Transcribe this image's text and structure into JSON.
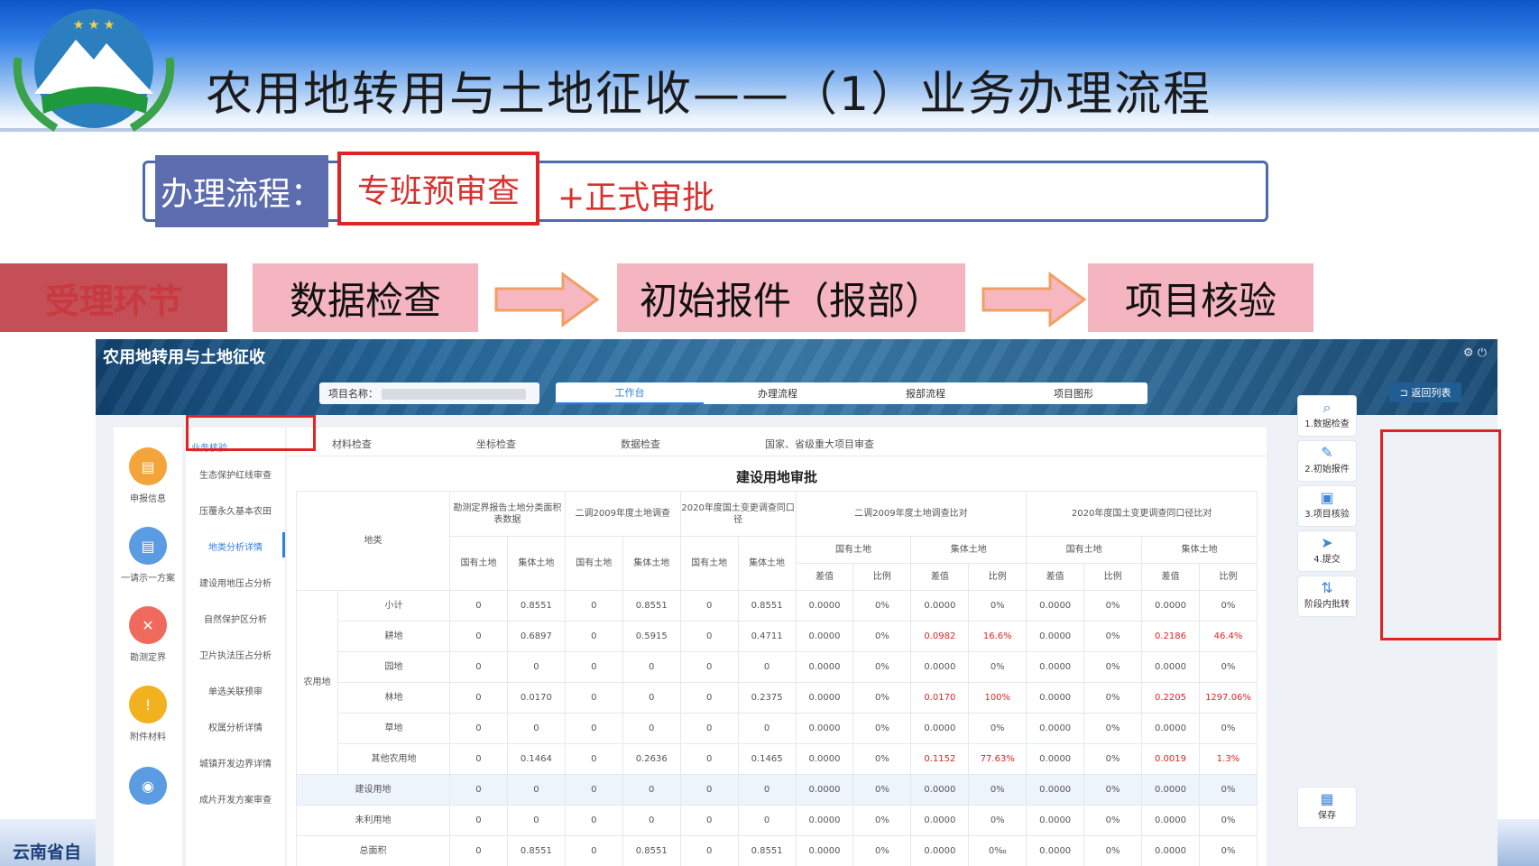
{
  "slide": {
    "title": "农用地转用与土地征收——（1）业务办理流程",
    "footer_text": "云南省自"
  },
  "process": {
    "label": "办理流程：",
    "step1": "专班预审查",
    "step2": "+正式审批"
  },
  "stages": {
    "label": "受理环节",
    "items": [
      "数据检查",
      "初始报件（报部）",
      "项目核验"
    ]
  },
  "app": {
    "title": "农用地转用与土地征收",
    "project_name_label": "项目名称：",
    "tabs": [
      "工作台",
      "办理流程",
      "报部流程",
      "项目图形"
    ],
    "active_tab": "工作台",
    "back_label": "返回列表",
    "left_nav": [
      "申报信息",
      "一请示一方案",
      "勘测定界",
      "附件材料"
    ],
    "sub_nav": {
      "header": "业务核验",
      "items": [
        "生态保护红线审查",
        "压覆永久基本农田",
        "地类分析详情",
        "建设用地压占分析",
        "自然保护区分析",
        "卫片执法压占分析",
        "单选关联预审",
        "权属分析详情",
        "城镇开发边界详情",
        "成片开发方案审查"
      ],
      "active": "地类分析详情"
    },
    "sub_tabs": [
      "材料检查",
      "坐标检查",
      "数据检查",
      "国家、省级重大项目审查"
    ],
    "table_title": "建设用地审批",
    "header": {
      "land_type": "地类",
      "group_survey": "勘测定界报告土地分类面积表数据",
      "group_2009": "二调2009年度土地调查",
      "group_2020": "2020年度国土变更调查同口径",
      "group_cmp2009": "二调2009年度土地调查比对",
      "group_cmp2020": "2020年度国土变更调查同口径比对",
      "state_land": "国有土地",
      "collective_land": "集体土地",
      "diff": "差值",
      "ratio": "比例"
    },
    "rows": [
      {
        "group": "农用地",
        "name": "小计",
        "values": [
          "0",
          "0.8551",
          "0",
          "0.8551",
          "0",
          "0.8551",
          "0.0000",
          "0%",
          "0.0000",
          "0%",
          "0.0000",
          "0%",
          "0.0000",
          "0%"
        ]
      },
      {
        "group": "",
        "name": "耕地",
        "values": [
          "0",
          "0.6897",
          "0",
          "0.5915",
          "0",
          "0.4711",
          "0.0000",
          "0%",
          "0.0982",
          "16.6%",
          "0.0000",
          "0%",
          "0.2186",
          "46.4%"
        ]
      },
      {
        "group": "",
        "name": "园地",
        "values": [
          "0",
          "0",
          "0",
          "0",
          "0",
          "0",
          "0.0000",
          "0%",
          "0.0000",
          "0%",
          "0.0000",
          "0%",
          "0.0000",
          "0%"
        ]
      },
      {
        "group": "",
        "name": "林地",
        "values": [
          "0",
          "0.0170",
          "0",
          "0",
          "0",
          "0.2375",
          "0.0000",
          "0%",
          "0.0170",
          "100%",
          "0.0000",
          "0%",
          "0.2205",
          "1297.06%"
        ]
      },
      {
        "group": "",
        "name": "草地",
        "values": [
          "0",
          "0",
          "0",
          "0",
          "0",
          "0",
          "0.0000",
          "0%",
          "0.0000",
          "0%",
          "0.0000",
          "0%",
          "0.0000",
          "0%"
        ]
      },
      {
        "group": "",
        "name": "其他农用地",
        "values": [
          "0",
          "0.1464",
          "0",
          "0.2636",
          "0",
          "0.1465",
          "0.0000",
          "0%",
          "0.1152",
          "77.63%",
          "0.0000",
          "0%",
          "0.0019",
          "1.3%"
        ]
      },
      {
        "group": "建设用地",
        "name": "",
        "values": [
          "0",
          "0",
          "0",
          "0",
          "0",
          "0",
          "0.0000",
          "0%",
          "0.0000",
          "0%",
          "0.0000",
          "0%",
          "0.0000",
          "0%"
        ]
      },
      {
        "group": "未利用地",
        "name": "",
        "values": [
          "0",
          "0",
          "0",
          "0",
          "0",
          "0",
          "0.0000",
          "0%",
          "0.0000",
          "0%",
          "0.0000",
          "0%",
          "0.0000",
          "0%"
        ]
      },
      {
        "group": "总面积",
        "name": "",
        "values": [
          "0",
          "0.8551",
          "0",
          "0.8551",
          "0",
          "0.8551",
          "0.0000",
          "0%",
          "0.0000",
          "0‰",
          "0.0000",
          "0%",
          "0.0000",
          "0%"
        ]
      }
    ],
    "right_rail": [
      "1.数据检查",
      "2.初始报件",
      "3.项目核验",
      "4.提交",
      "阶段内批转"
    ],
    "save_label": "保存"
  },
  "colors": {
    "highlight_red": "#e02424",
    "stage_pink": "#f4b4c0",
    "accent_blue": "#2f7fe0",
    "red_value": "#e02424"
  }
}
